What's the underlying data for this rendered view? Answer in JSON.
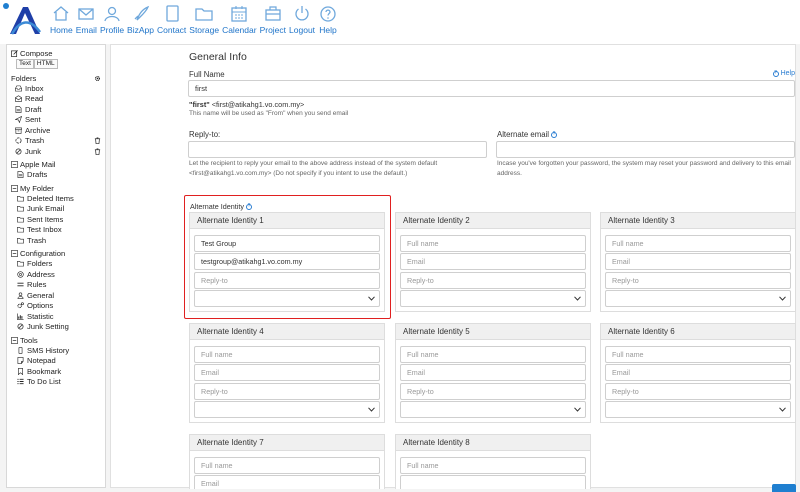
{
  "nav": [
    {
      "label": "Home",
      "icon": "home-icon"
    },
    {
      "label": "Email",
      "icon": "email-icon"
    },
    {
      "label": "Profile",
      "icon": "profile-icon"
    },
    {
      "label": "BizApp",
      "icon": "bizapp-icon"
    },
    {
      "label": "Contact",
      "icon": "contact-icon"
    },
    {
      "label": "Storage",
      "icon": "storage-icon"
    },
    {
      "label": "Calendar",
      "icon": "calendar-icon"
    },
    {
      "label": "Project",
      "icon": "project-icon"
    },
    {
      "label": "Logout",
      "icon": "logout-icon"
    },
    {
      "label": "Help",
      "icon": "help-icon"
    }
  ],
  "sidebar": {
    "compose": "Compose",
    "compose_text": "Text",
    "compose_html": "HTML",
    "folders_title": "Folders",
    "folders": [
      "Inbox",
      "Read",
      "Draft",
      "Sent",
      "Archive",
      "Trash",
      "Junk"
    ],
    "apple_title": "Apple Mail",
    "apple": [
      "Drafts"
    ],
    "myfolder_title": "My Folder",
    "myfolder": [
      "Deleted Items",
      "Junk Email",
      "Sent Items",
      "Test Inbox",
      "Trash"
    ],
    "config_title": "Configuration",
    "config": [
      "Folders",
      "Address",
      "Rules",
      "General",
      "Options",
      "Statistic",
      "Junk Setting"
    ],
    "tools_title": "Tools",
    "tools": [
      "SMS History",
      "Notepad",
      "Bookmark",
      "To Do List"
    ]
  },
  "main": {
    "title": "General Info",
    "full_name_label": "Full Name",
    "help": "Help",
    "full_name_value": "first",
    "from_name": "\"first\"",
    "from_email": "<first@atikahg1.vo.com.my>",
    "from_hint": "This name will be used as \"From\" when you send email",
    "reply_to_label": "Reply-to:",
    "reply_hint_1": "Let the recipient to reply your email to the above address instead of the system default",
    "reply_hint_2": "<first@atikahg1.vo.com.my> (Do not specify if you intent to use the default.)",
    "alt_email_label": "Alternate email",
    "alt_hint_1": "Incase you've forgotten your password, the system may reset your password and delivery to this email",
    "alt_hint_2": "address.",
    "alt_identity_label": "Alternate Identity",
    "identities": [
      {
        "title": "Alternate Identity 1",
        "name": "Test Group",
        "email": "testgroup@atikahg1.vo.com.my",
        "reply": "Reply-to"
      },
      {
        "title": "Alternate Identity 2",
        "name": "Full name",
        "email": "Email",
        "reply": "Reply-to"
      },
      {
        "title": "Alternate Identity 3",
        "name": "Full name",
        "email": "Email",
        "reply": "Reply-to"
      },
      {
        "title": "Alternate Identity 4",
        "name": "Full name",
        "email": "Email",
        "reply": "Reply-to"
      },
      {
        "title": "Alternate Identity 5",
        "name": "Full name",
        "email": "Email",
        "reply": "Reply-to"
      },
      {
        "title": "Alternate Identity 6",
        "name": "Full name",
        "email": "Email",
        "reply": "Reply-to"
      },
      {
        "title": "Alternate Identity 7",
        "name": "Full name",
        "email": "Email",
        "reply": ""
      },
      {
        "title": "Alternate Identity 8",
        "name": "Full name",
        "email": "",
        "reply": ""
      }
    ]
  },
  "colors": {
    "accent": "#1f7fd0",
    "highlight": "#e02020"
  }
}
